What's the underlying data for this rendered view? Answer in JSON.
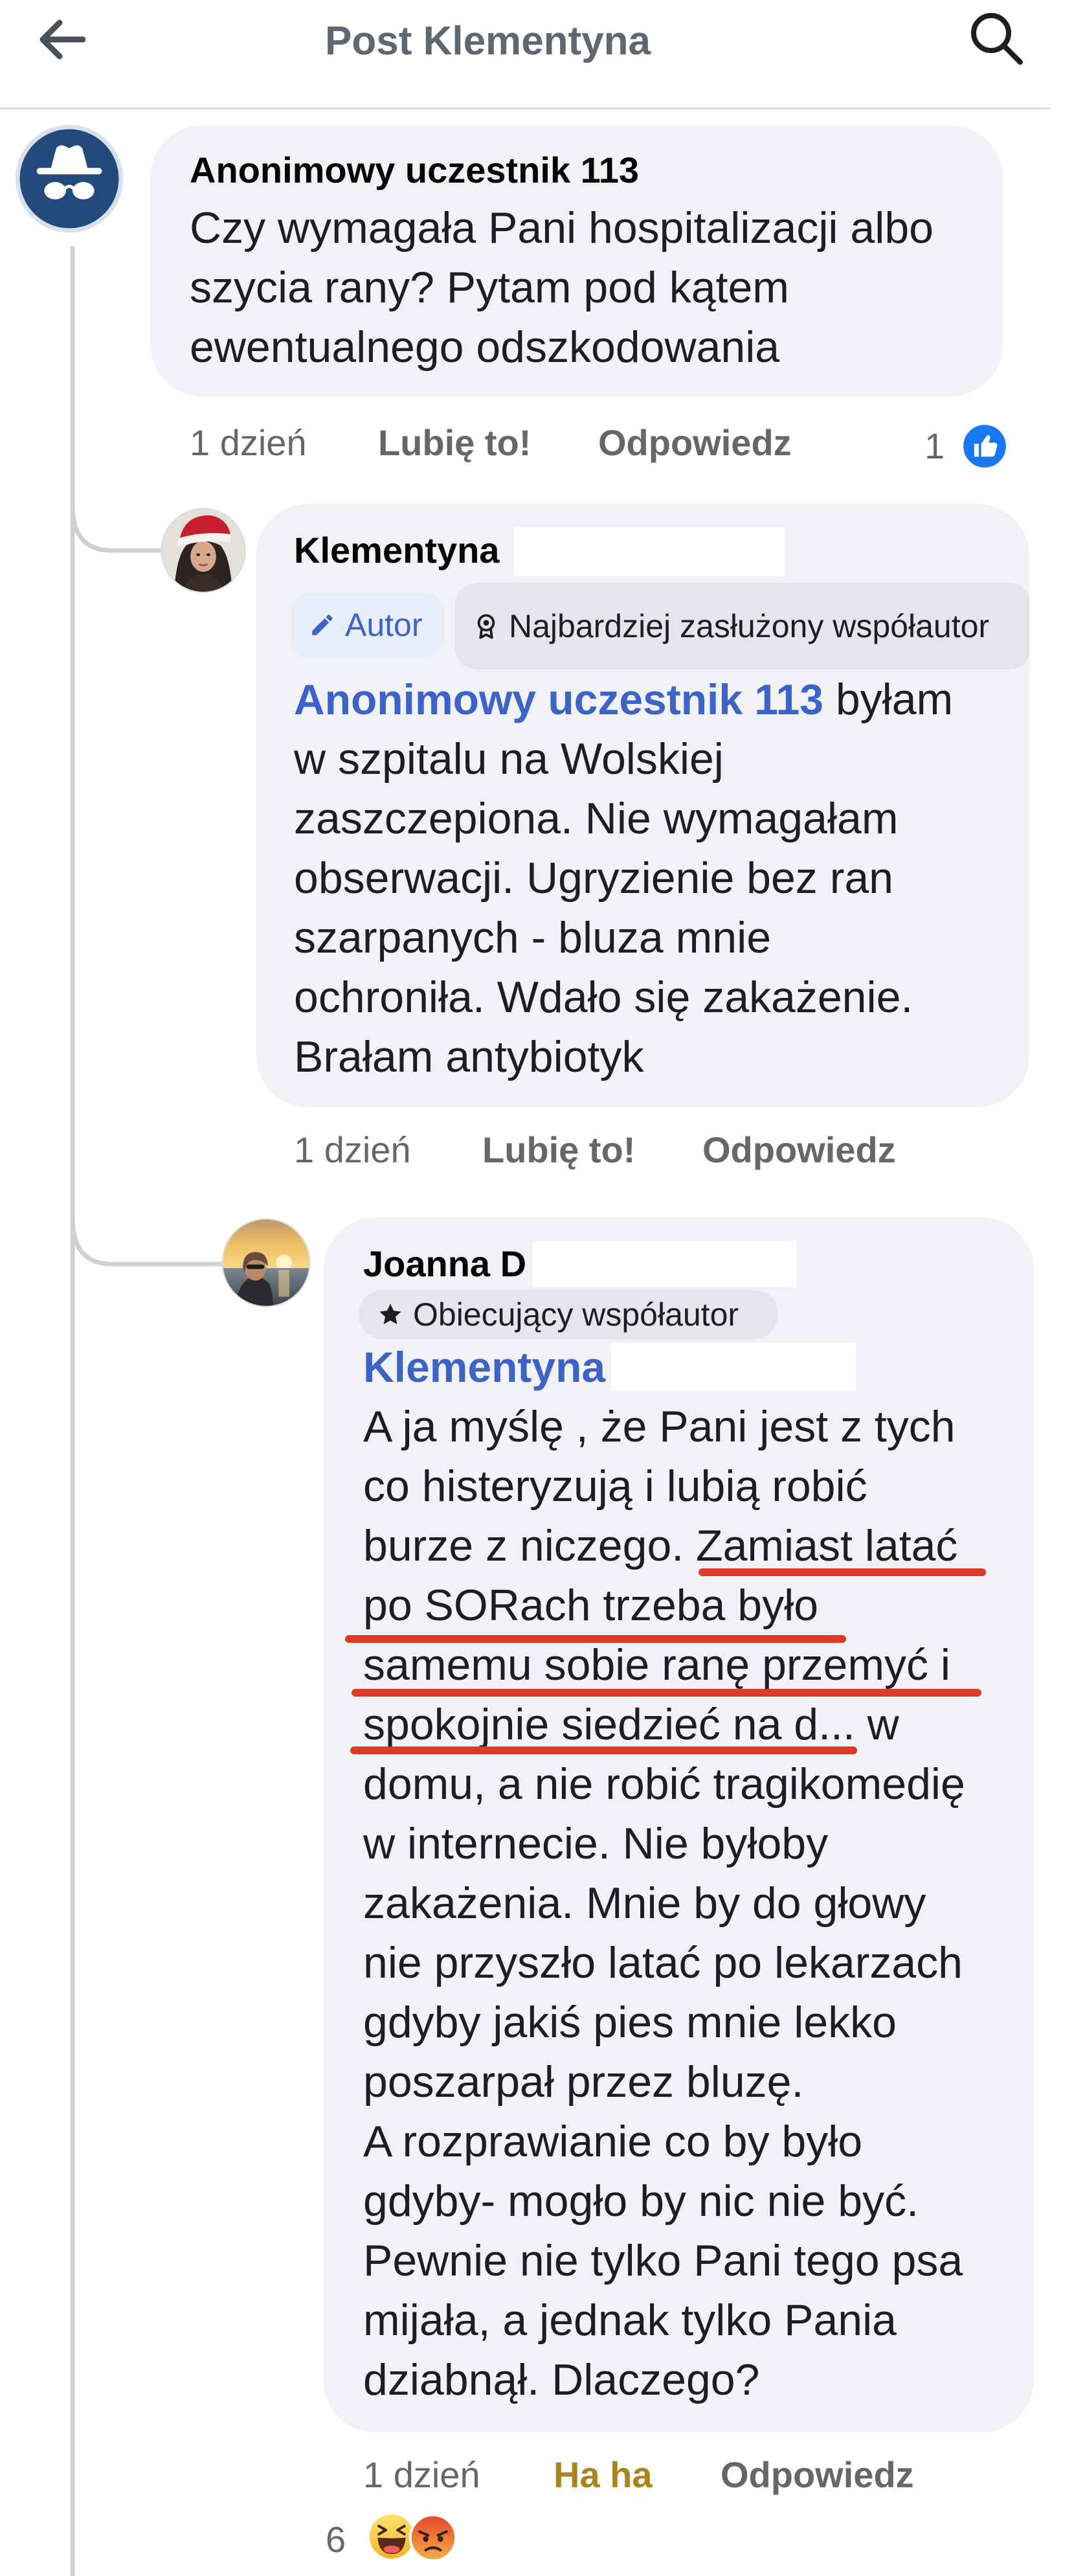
{
  "header": {
    "title": "Post Klementyna",
    "back_icon": "arrow-left-icon",
    "search_icon": "search-icon"
  },
  "comments": [
    {
      "author": "Anonimowy uczestnik 113",
      "avatar": "incognito-icon",
      "lines": [
        "Czy wymagała Pani hospitalizacji albo",
        "szycia rany? Pytam pod kątem",
        "ewentualnego odszkodowania"
      ],
      "time": "1 dzień",
      "like": "Lubię to!",
      "reply": "Odpowiedz",
      "reaction_count": "1",
      "reaction_icons": [
        "like-icon"
      ]
    },
    {
      "author": "Klementyna",
      "avatar": "profile-photo",
      "badges": [
        {
          "label": "Autor",
          "icon": "pencil-icon"
        },
        {
          "label": "Najbardziej zasłużony współautor",
          "icon": "medal-icon"
        }
      ],
      "mention": "Anonimowy uczestnik 113",
      "first_line_rest": " byłam",
      "lines": [
        "w szpitalu na Wolskiej",
        "zaszczepiona. Nie wymagałam",
        "obserwacji. Ugryzienie bez ran",
        "szarpanych - bluza mnie",
        "ochroniła. Wdało się zakażenie.",
        "Brałam antybiotyk"
      ],
      "time": "1 dzień",
      "like": "Lubię to!",
      "reply": "Odpowiedz"
    },
    {
      "author": "Joanna D",
      "avatar": "profile-photo",
      "badges": [
        {
          "label": "Obiecujący współautor",
          "icon": "star-icon"
        }
      ],
      "mention": "Klementyna",
      "lines": [
        "A ja myślę , że Pani jest z tych",
        "co histeryzują i lubią robić",
        "burze z niczego. Zamiast latać",
        "po SORach trzeba było",
        "samemu sobie ranę przemyć i",
        "spokojnie siedzieć na d... w",
        "domu, a nie robić tragikomedię",
        "w internecie. Nie byłoby",
        "zakażenia. Mnie by do głowy",
        "nie przyszło latać po lekarzach",
        "gdyby jakiś pies mnie lekko",
        "poszarpał przez bluzę.",
        "A rozprawianie co by było",
        "gdyby- mogło by nic nie być.",
        "Pewnie nie tylko Pani tego psa",
        "mijała, a jednak tylko Pania",
        "dziabnął. Dlaczego?"
      ],
      "time": "1 dzień",
      "reaction_label": "Ha ha",
      "reply": "Odpowiedz",
      "reaction_count": "6",
      "reaction_icons": [
        "haha-emoji-icon",
        "angry-emoji-icon"
      ]
    }
  ],
  "colors": {
    "bubble": "#f0f2f5",
    "mention_blue": "#3d63c9",
    "like_blue": "#1877f2",
    "haha_gold": "#a8861c",
    "secondary_text": "#65676b",
    "thread_line": "#ced0d4",
    "annotation_red": "#dd3b2a"
  }
}
